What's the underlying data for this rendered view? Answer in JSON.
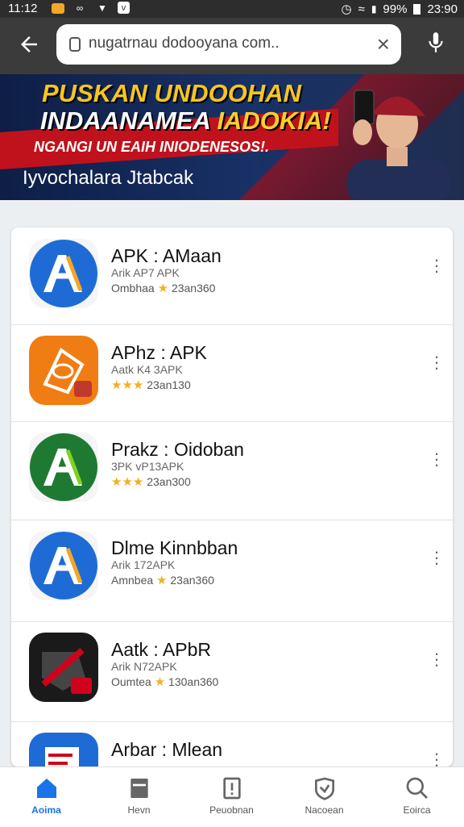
{
  "status_bar": {
    "time": "11:12",
    "battery": "99%",
    "clock_right": "23:90"
  },
  "browser": {
    "url": "nugatrnau dodooyana com..",
    "back_icon": "arrow-left-icon",
    "clear_icon": "close-icon",
    "mic_icon": "mic-icon"
  },
  "banner": {
    "headline1": "PUSKAN UNDOOHAN",
    "headline2_a": "INDAANAMEA",
    "headline2_b": "IADOKIA!",
    "subheadline": "NGANGI UN EAIH INIODENESOS!.",
    "caption": "Iyvochalara Jtabcak",
    "search_icon": "search-icon",
    "menu_icon": "list-icon"
  },
  "apps": [
    {
      "name": "APK : AMaan",
      "dev": "Arik AP7 APK",
      "rating_text": "Ombhaa",
      "stars": 1,
      "downloads": "23an360",
      "icon": "ab-blue",
      "color": "#1e6bd6"
    },
    {
      "name": "APhz : APK",
      "dev": "Aatk  K4 3APK",
      "rating_text": "",
      "stars": 3,
      "downloads": "23an130",
      "icon": "apk-orange",
      "color": "#f07d14"
    },
    {
      "name": "Prakz : Oidoban",
      "dev": "3PK  vP13APK",
      "rating_text": "",
      "stars": 3,
      "downloads": "23an300",
      "icon": "ab-green",
      "color": "#1e7a33"
    },
    {
      "name": "Dlme Kinnbban",
      "dev": "Arik  172APK",
      "rating_text": "Amnbea",
      "stars": 1,
      "downloads": "23an360",
      "icon": "ab-blue",
      "color": "#1e6bd6"
    },
    {
      "name": "Aatk : APbR",
      "dev": "Arik  N72APK",
      "rating_text": "Oumtea",
      "stars": 1,
      "downloads": "130an360",
      "icon": "apk-dark",
      "color": "#1a1a1a"
    },
    {
      "name": "Arbar : Mlean",
      "dev": "",
      "rating_text": "",
      "stars": 0,
      "downloads": "",
      "icon": "doc-blue",
      "color": "#1e6bd6"
    }
  ],
  "bottom_nav": [
    {
      "label": "Aoima",
      "icon": "home-icon",
      "active": true
    },
    {
      "label": "Hevn",
      "icon": "card-icon",
      "active": false
    },
    {
      "label": "Peuobnan",
      "icon": "alert-icon",
      "active": false
    },
    {
      "label": "Nacoean",
      "icon": "shield-icon",
      "active": false
    },
    {
      "label": "Eoirca",
      "icon": "search-icon",
      "active": false
    }
  ]
}
